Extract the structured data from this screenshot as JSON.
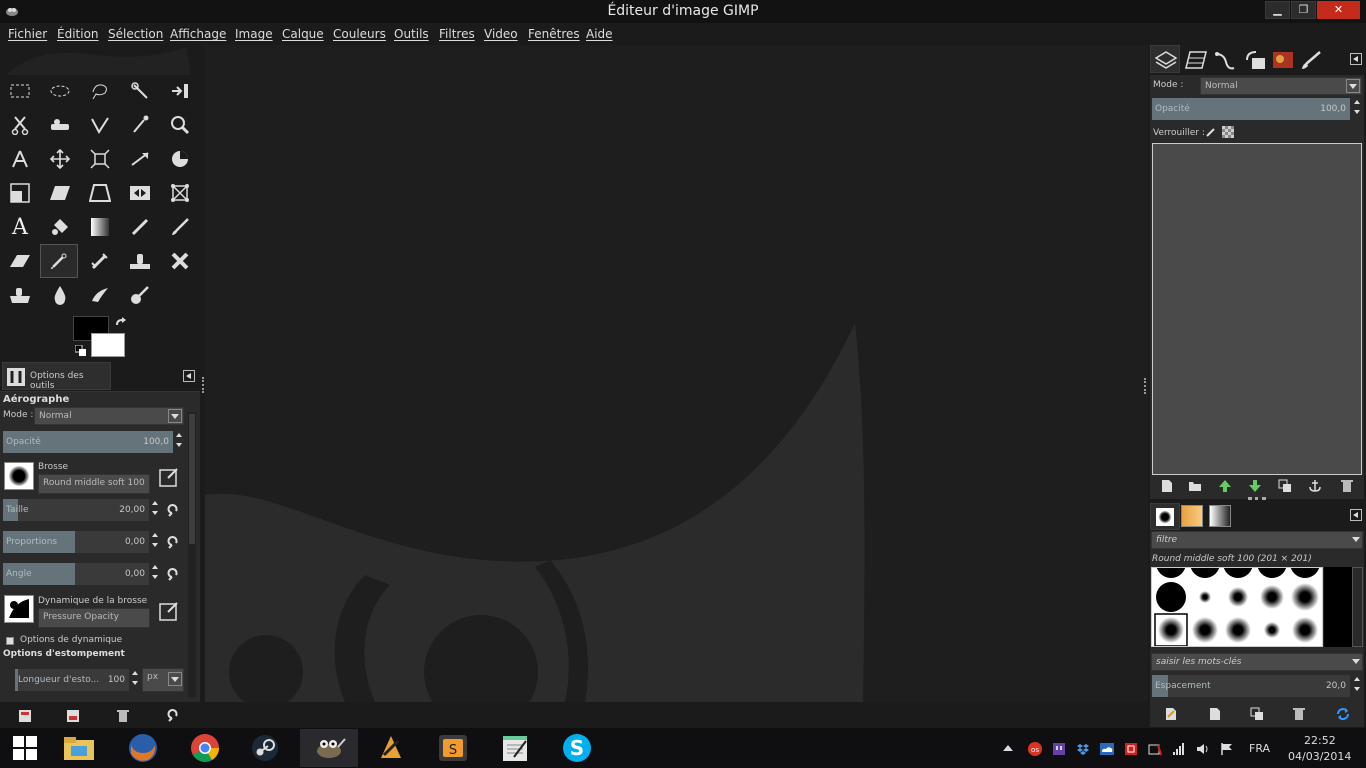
{
  "window": {
    "title": "Éditeur d'image GIMP",
    "controls": [
      "minimize",
      "restore",
      "close"
    ]
  },
  "menubar": {
    "items": [
      "Fichier",
      "Édition",
      "Sélection",
      "Affichage",
      "Image",
      "Calque",
      "Couleurs",
      "Outils",
      "Filtres",
      "Video",
      "Fenêtres",
      "Aide"
    ]
  },
  "toolbox": {
    "tools": [
      "rect-select",
      "ellipse-select",
      "free-select",
      "fuzzy-select",
      "foreground-select",
      "scissors",
      "heal",
      "paths",
      "color-picker",
      "zoom",
      "measure",
      "move",
      "align",
      "flip",
      "crop",
      "rotate",
      "scale",
      "shear",
      "perspective",
      "cage",
      "text",
      "bucket-fill",
      "blend",
      "pencil",
      "paintbrush",
      "eraser",
      "airbrush",
      "ink",
      "clone",
      "heal-alt",
      "perspective-clone",
      "blur",
      "smudge",
      "dodge-burn"
    ],
    "active_tool": "airbrush"
  },
  "tool_options": {
    "tab_label": "Options des outils",
    "tool_name": "Aérographe",
    "mode_label": "Mode :",
    "mode_value": "Normal",
    "opacity_label": "Opacité",
    "opacity_value": "100,0",
    "brush_label": "Brosse",
    "brush_value": "Round  middle soft 100",
    "size_label": "Taille",
    "size_value": "20,00",
    "proportions_label": "Proportions",
    "proportions_value": "0,00",
    "angle_label": "Angle",
    "angle_value": "0,00",
    "dynamics_label": "Dynamique de la brosse",
    "dynamics_value": "Pressure Opacity",
    "dynamics_options_label": "Options de dynamique",
    "fade_options_label": "Options d'estompement",
    "fade_length_label": "Longueur d'esto...",
    "fade_length_value": "100",
    "fade_unit": "px"
  },
  "layers_panel": {
    "mode_label": "Mode :",
    "mode_value": "Normal",
    "opacity_label": "Opacité",
    "opacity_value": "100,0",
    "lock_label": "Verrouiller :"
  },
  "brushes_panel": {
    "filter_placeholder": "filtre",
    "brush_name": "Round  middle soft 100 (201 × 201)",
    "tags_placeholder": "saisir les mots-clés",
    "spacing_label": "Espacement",
    "spacing_value": "20,0"
  },
  "taskbar": {
    "apps": [
      "start",
      "file-explorer",
      "firefox",
      "chrome",
      "steam",
      "gimp",
      "winamp",
      "sublime-text",
      "notepad",
      "skype"
    ],
    "language": "FRA",
    "time": "22:52",
    "date": "04/03/2014"
  },
  "colors": {
    "background": "#1b1b1b",
    "canvas": "#1e1e1e",
    "wilber": "#2b2b2b",
    "slider_fill": "#65737b",
    "close_button": "#c42b1c"
  }
}
